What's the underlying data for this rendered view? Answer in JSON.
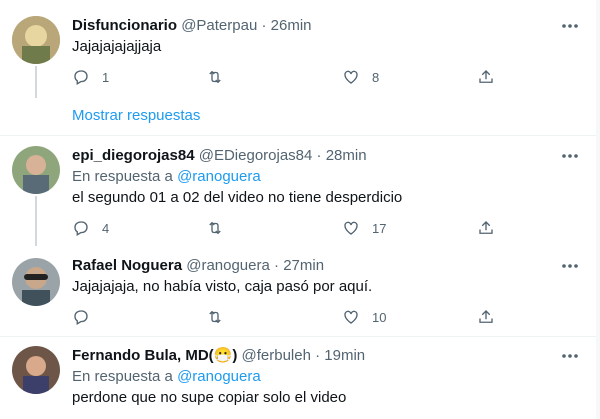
{
  "tweets": [
    {
      "name": "Disfuncionario",
      "handle": "@Paterpau",
      "time": "26min",
      "text": "Jajajajajajjaja",
      "reply_count": "1",
      "retweet_count": "",
      "like_count": "8"
    },
    {
      "name": "epi_diegorojas84",
      "handle": "@EDiegorojas84",
      "time": "28min",
      "reply_prefix": "En respuesta a ",
      "reply_handle": "@ranoguera",
      "text": "el segundo 01 a 02 del video no tiene desperdicio",
      "reply_count": "4",
      "retweet_count": "",
      "like_count": "17"
    },
    {
      "name": "Rafael Noguera",
      "handle": "@ranoguera",
      "time": "27min",
      "text": "Jajajajaja, no había visto, caja pasó por aquí.",
      "reply_count": "",
      "retweet_count": "",
      "like_count": "10"
    },
    {
      "name": "Fernando Bula, MD(😷)",
      "handle": "@ferbuleh",
      "time": "19min",
      "reply_prefix": "En respuesta a ",
      "reply_handle": "@ranoguera",
      "text": "perdone que no supe copiar solo el video"
    }
  ],
  "show_replies": "Mostrar respuestas",
  "separator": "·",
  "icons": {
    "more": "more-icon",
    "reply": "reply-icon",
    "retweet": "retweet-icon",
    "like": "like-icon",
    "share": "share-icon"
  },
  "colors": {
    "link": "#1d9bf0",
    "muted": "#536471",
    "text": "#0f1419"
  }
}
